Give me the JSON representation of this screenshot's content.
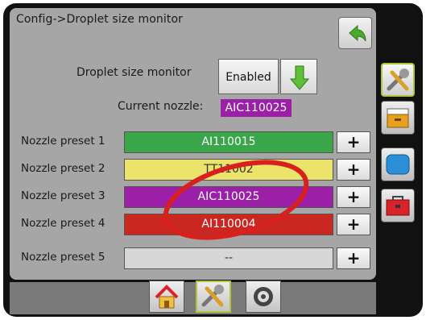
{
  "header": {
    "title": "Config->Droplet size monitor"
  },
  "droplet_monitor": {
    "label": "Droplet size monitor",
    "value": "Enabled"
  },
  "current_nozzle": {
    "label": "Current nozzle:",
    "value": "AIC110025",
    "color": "#9c1fa8"
  },
  "presets": [
    {
      "label": "Nozzle preset 1",
      "value": "AI110015",
      "color": "#3aa64a",
      "text_color": "#ffffff"
    },
    {
      "label": "Nozzle preset 2",
      "value": "TT11002",
      "color": "#ece36a",
      "text_color": "#333333"
    },
    {
      "label": "Nozzle preset 3",
      "value": "AIC110025",
      "color": "#9c1fa8",
      "text_color": "#ffffff"
    },
    {
      "label": "Nozzle preset 4",
      "value": "AI110004",
      "color": "#c9271f",
      "text_color": "#ffffff"
    },
    {
      "label": "Nozzle preset 5",
      "value": "--",
      "color": "#d6d6d6",
      "text_color": "#333333"
    }
  ],
  "plus_label": "+",
  "sidebar": [
    "tools-icon",
    "storage-box-icon",
    "display-icon",
    "toolbox-icon"
  ],
  "tabs": [
    "home-icon",
    "tools-icon",
    "gauge-icon"
  ],
  "annotation": {
    "color": "#d8201f"
  }
}
